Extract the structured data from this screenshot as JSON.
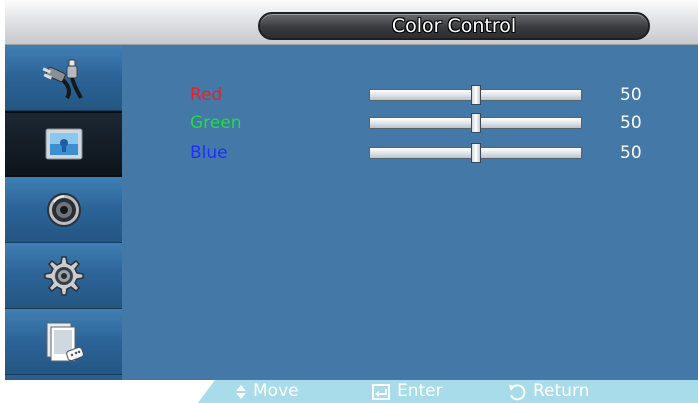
{
  "header": {
    "title": "Color Control"
  },
  "sidebar": {
    "items": [
      {
        "icon": "input-plug-icon",
        "selected": false
      },
      {
        "icon": "picture-icon",
        "selected": true
      },
      {
        "icon": "sound-speaker-icon",
        "selected": false
      },
      {
        "icon": "setup-gear-icon",
        "selected": false
      },
      {
        "icon": "multi-control-icon",
        "selected": false
      }
    ]
  },
  "settings": [
    {
      "label": "Red",
      "value": "50",
      "level": 0.5,
      "color": "#e8212a"
    },
    {
      "label": "Green",
      "value": "50",
      "level": 0.5,
      "color": "#22dd3c"
    },
    {
      "label": "Blue",
      "value": "50",
      "level": 0.5,
      "color": "#1f2fff"
    }
  ],
  "footer": {
    "move_label": "Move",
    "enter_label": "Enter",
    "return_label": "Return"
  },
  "colors": {
    "panel": "#4478a7",
    "sidebar": "#2c6397",
    "footer": "#a8dceb"
  }
}
